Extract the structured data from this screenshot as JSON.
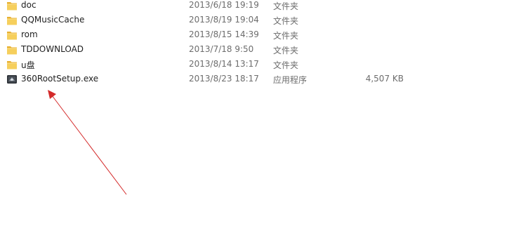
{
  "files": [
    {
      "name": "doc",
      "date": "2013/6/18 19:19",
      "type": "文件夹",
      "size": "",
      "icon": "folder-icon"
    },
    {
      "name": "QQMusicCache",
      "date": "2013/8/19 19:04",
      "type": "文件夹",
      "size": "",
      "icon": "folder-icon"
    },
    {
      "name": "rom",
      "date": "2013/8/15 14:39",
      "type": "文件夹",
      "size": "",
      "icon": "folder-icon"
    },
    {
      "name": "TDDOWNLOAD",
      "date": "2013/7/18 9:50",
      "type": "文件夹",
      "size": "",
      "icon": "folder-icon"
    },
    {
      "name": "u盘",
      "date": "2013/8/14 13:17",
      "type": "文件夹",
      "size": "",
      "icon": "folder-icon"
    },
    {
      "name": "360RootSetup.exe",
      "date": "2013/8/23 18:17",
      "type": "应用程序",
      "size": "4,507 KB",
      "icon": "exe-icon"
    }
  ],
  "colors": {
    "folder": "#f5c542",
    "annotation_arrow": "#d42a2a"
  }
}
